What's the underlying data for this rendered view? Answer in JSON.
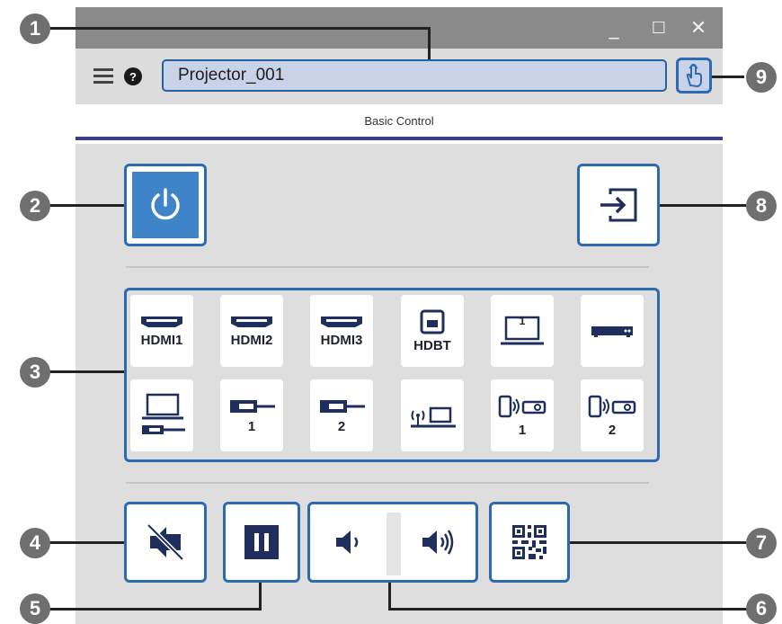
{
  "window": {
    "controls": {
      "minimize": "_",
      "maximize": "☐",
      "close": "✕"
    }
  },
  "toolbar": {
    "projector_name": "Projector_001",
    "menu_icon": "hamburger-menu-icon",
    "help_icon": "help-icon",
    "touch_icon": "touch-hand-icon"
  },
  "subheader": {
    "title": "Basic Control"
  },
  "callouts": [
    "1",
    "2",
    "3",
    "4",
    "5",
    "6",
    "7",
    "8",
    "9"
  ],
  "sources": [
    {
      "icon": "hdmi-icon",
      "label": "HDMI1"
    },
    {
      "icon": "hdmi-icon",
      "label": "HDMI2"
    },
    {
      "icon": "hdmi-icon",
      "label": "HDMI3"
    },
    {
      "icon": "ethernet-icon",
      "label": "HDBT"
    },
    {
      "icon": "computer-icon",
      "label": "1"
    },
    {
      "icon": "video-device-icon",
      "label": ""
    },
    {
      "icon": "usb-display-icon",
      "label": ""
    },
    {
      "icon": "usb-icon",
      "label": "1"
    },
    {
      "icon": "usb-icon",
      "label": "2"
    },
    {
      "icon": "network-icon",
      "label": ""
    },
    {
      "icon": "screen-mirroring-icon",
      "label": "1"
    },
    {
      "icon": "screen-mirroring-icon",
      "label": "2"
    }
  ],
  "colors": {
    "accent": "#2d6bb0",
    "panel": "#dedede",
    "titlebar": "#8a8a8a",
    "dark_blue": "#1f2e5c"
  }
}
